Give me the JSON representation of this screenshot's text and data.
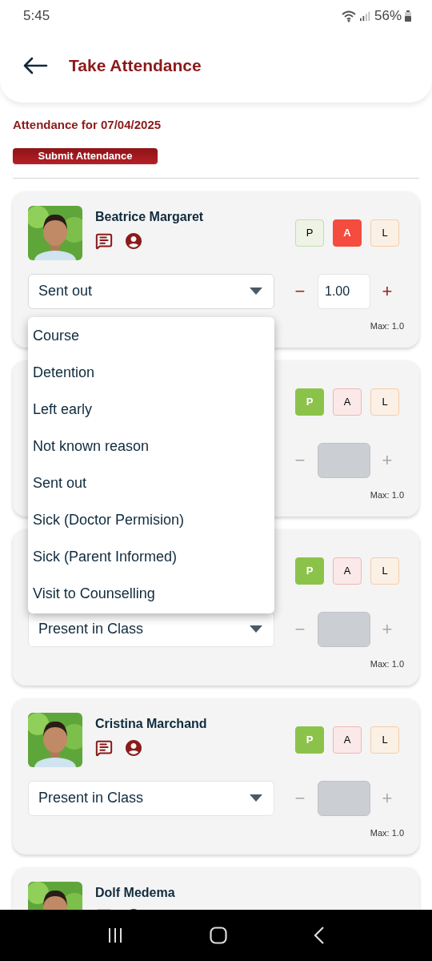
{
  "status_bar": {
    "time": "5:45",
    "battery": "56%"
  },
  "header": {
    "title": "Take Attendance"
  },
  "date_label": "Attendance for 07/04/2025",
  "submit_button": "Submit Attendance",
  "students": [
    {
      "name": "Beatrice Margaret",
      "marks": [
        {
          "label": "P",
          "kind": "present",
          "selected": false
        },
        {
          "label": "A",
          "kind": "absent",
          "selected": true
        },
        {
          "label": "L",
          "kind": "late",
          "selected": false
        }
      ],
      "reason": "Sent out",
      "expanded": true,
      "stepper": {
        "enabled": true,
        "minus": "−",
        "value": "1.00",
        "plus": "+"
      },
      "max": "Max: 1.0"
    },
    {
      "marks": [
        {
          "label": "P",
          "kind": "present",
          "selected": true
        },
        {
          "label": "A",
          "kind": "absent",
          "selected": false
        },
        {
          "label": "L",
          "kind": "late",
          "selected": false
        }
      ],
      "expanded": false,
      "stepper": {
        "enabled": false,
        "minus": "−",
        "plus": "+"
      },
      "max": "Max: 1.0"
    },
    {
      "marks": [
        {
          "label": "P",
          "kind": "present",
          "selected": true
        },
        {
          "label": "A",
          "kind": "absent",
          "selected": false
        },
        {
          "label": "L",
          "kind": "late",
          "selected": false
        }
      ],
      "reason": "Present in Class",
      "expanded": false,
      "stepper": {
        "enabled": false,
        "minus": "−",
        "plus": "+"
      },
      "max": "Max: 1.0"
    },
    {
      "name": "Cristina Marchand",
      "marks": [
        {
          "label": "P",
          "kind": "present",
          "selected": true
        },
        {
          "label": "A",
          "kind": "absent",
          "selected": false
        },
        {
          "label": "L",
          "kind": "late",
          "selected": false
        }
      ],
      "reason": "Present in Class",
      "expanded": false,
      "stepper": {
        "enabled": false,
        "minus": "−",
        "plus": "+"
      },
      "max": "Max: 1.0"
    },
    {
      "name": "Dolf Medema"
    }
  ],
  "reason_options": [
    "Course",
    "Detention",
    "Left early",
    "Not known reason",
    "Sent out",
    "Sick (Doctor Permision)",
    "Sick (Parent Informed)",
    "Visit to Counselling"
  ]
}
